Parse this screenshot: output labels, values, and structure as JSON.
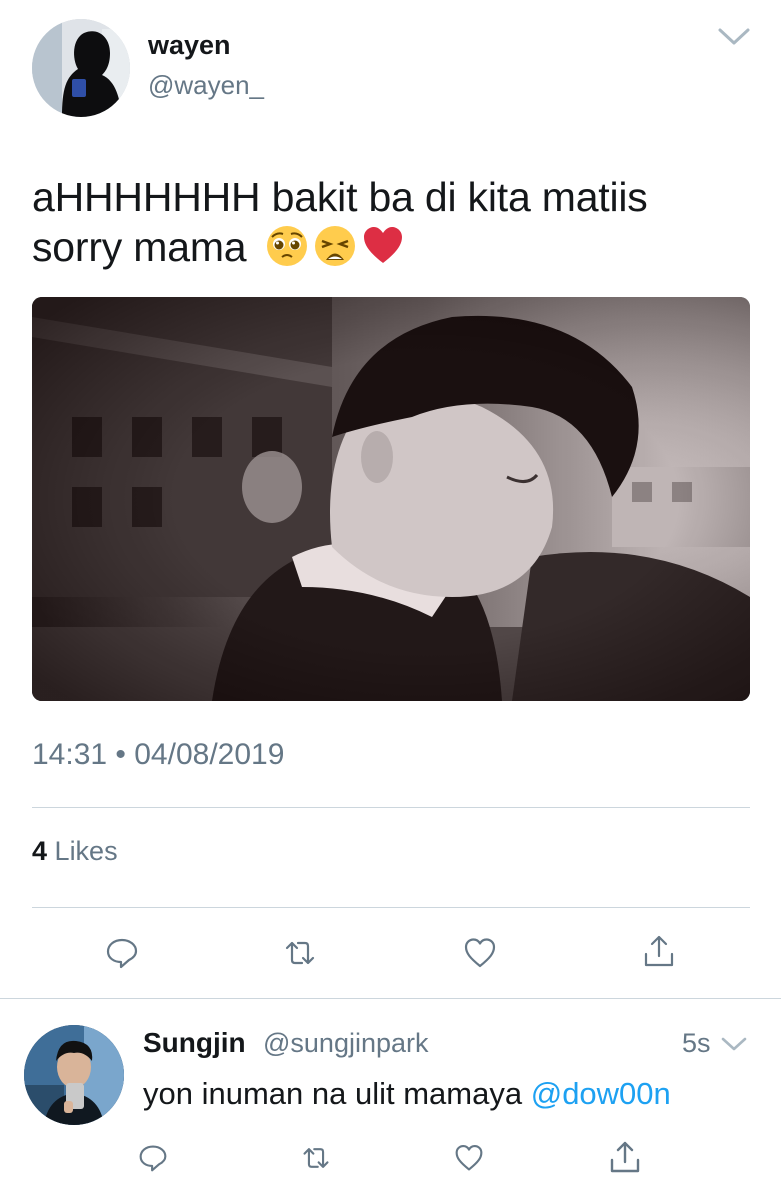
{
  "tweet": {
    "display_name": "wayen",
    "handle": "@wayen_",
    "text_line1": "aHHHHHHH bakit ba di kita matiis",
    "text_line2": "sorry mama",
    "emojis": [
      "pleading-face",
      "weary-face",
      "red-heart"
    ],
    "timestamp": "14:31 • 04/08/2019",
    "likes_count": "4",
    "likes_label": "Likes"
  },
  "actions": [
    "reply-icon",
    "retweet-icon",
    "like-icon",
    "share-icon"
  ],
  "reply": {
    "display_name": "Sungjin",
    "handle": "@sungjinpark",
    "time": "5s",
    "text": "yon inuman na ulit mamaya",
    "mention": "@dow00n"
  },
  "colors": {
    "text": "#14171a",
    "secondary": "#657786",
    "link": "#1da1f2",
    "divider": "#ccd6dd"
  }
}
